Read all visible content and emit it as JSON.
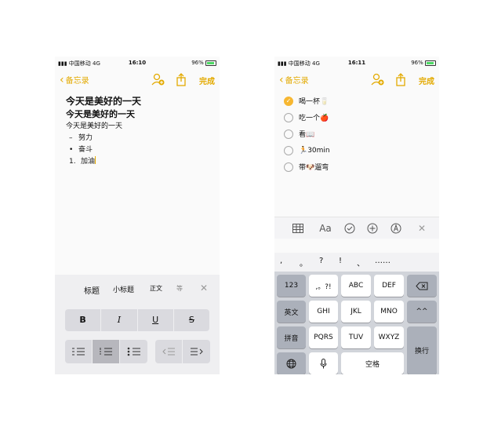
{
  "left_phone": {
    "status": {
      "carrier": "中国移动",
      "network": "4G",
      "time": "16:10",
      "battery": "96%"
    },
    "nav": {
      "back_label": "备忘录",
      "done_label": "完成"
    },
    "note": {
      "title": "今天是美好的一天",
      "heading": "今天是美好的一天",
      "body": "今天是美好的一天",
      "dash_item": "努力",
      "bullet_item": "奋斗",
      "numbered_marker": "1.",
      "numbered_item": "加油"
    },
    "format_panel": {
      "styles": [
        "标题",
        "小标题",
        "正文",
        "等"
      ],
      "close_icon": "close-icon",
      "text_styles": [
        "B",
        "I",
        "U",
        "S"
      ]
    }
  },
  "right_phone": {
    "status": {
      "carrier": "中国移动",
      "network": "4G",
      "time": "16:11",
      "battery": "96%"
    },
    "nav": {
      "back_label": "备忘录",
      "done_label": "完成"
    },
    "checklist": [
      {
        "label": "喝一杯🥛",
        "checked": true
      },
      {
        "label": "吃一个🍎",
        "checked": false
      },
      {
        "label": "看📖",
        "checked": false
      },
      {
        "label": "🏃30min",
        "checked": false
      },
      {
        "label": "带🐶遛弯",
        "checked": false
      }
    ],
    "toolbar": {
      "aa_label": "Aa",
      "icons": [
        "table-icon",
        "text-style-icon",
        "checklist-icon",
        "add-icon",
        "markup-icon",
        "close-icon"
      ]
    },
    "keyboard": {
      "punctuation": [
        ",",
        "。",
        "?",
        "!",
        "、",
        "……"
      ],
      "keys": {
        "num": "123",
        "punct": ",。?!",
        "abc": "ABC",
        "def": "DEF",
        "english": "英文",
        "ghi": "GHI",
        "jkl": "JKL",
        "mno": "MNO",
        "caret": "^^",
        "pinyin": "拼音",
        "pqrs": "PQRS",
        "tuv": "TUV",
        "wxyz": "WXYZ",
        "return": "换行",
        "space": "空格"
      }
    }
  },
  "colors": {
    "accent": "#e3aa00",
    "panel": "#efeff1",
    "keyboard_bg": "#d1d4da"
  }
}
